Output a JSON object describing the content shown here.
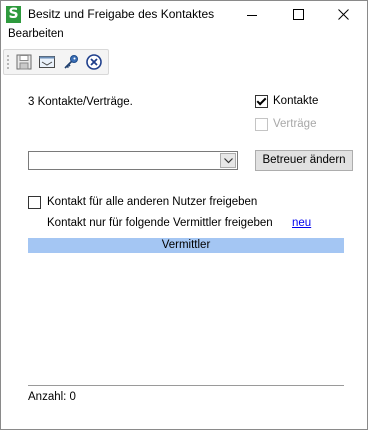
{
  "window": {
    "title": "Besitz und Freigabe des Kontaktes",
    "app_icon_letter": "S",
    "app_icon_color": "#2e9a3d"
  },
  "menu": {
    "items": [
      "Bearbeiten"
    ]
  },
  "toolbar": {
    "buttons": [
      {
        "icon": "save-icon"
      },
      {
        "icon": "window-icon"
      },
      {
        "icon": "key-icon"
      },
      {
        "icon": "cancel-icon"
      }
    ]
  },
  "main": {
    "count_text": "3 Kontakte/Verträge.",
    "kontakte": {
      "label": "Kontakte",
      "checked": true
    },
    "vertraege": {
      "label": "Verträge",
      "checked": false,
      "disabled": true
    },
    "betreuer": {
      "selected_value": "",
      "button_label": "Betreuer ändern"
    },
    "freigabe_alle": {
      "label": "Kontakt für alle anderen Nutzer freigeben",
      "checked": false
    },
    "freigabe_nur_label": "Kontakt nur für folgende Vermittler freigeben",
    "neu_link": "neu",
    "grid": {
      "columns": [
        "Vermittler"
      ],
      "rows": [],
      "header_color": "#a4c6f3"
    },
    "footer_count": "Anzahl: 0"
  }
}
